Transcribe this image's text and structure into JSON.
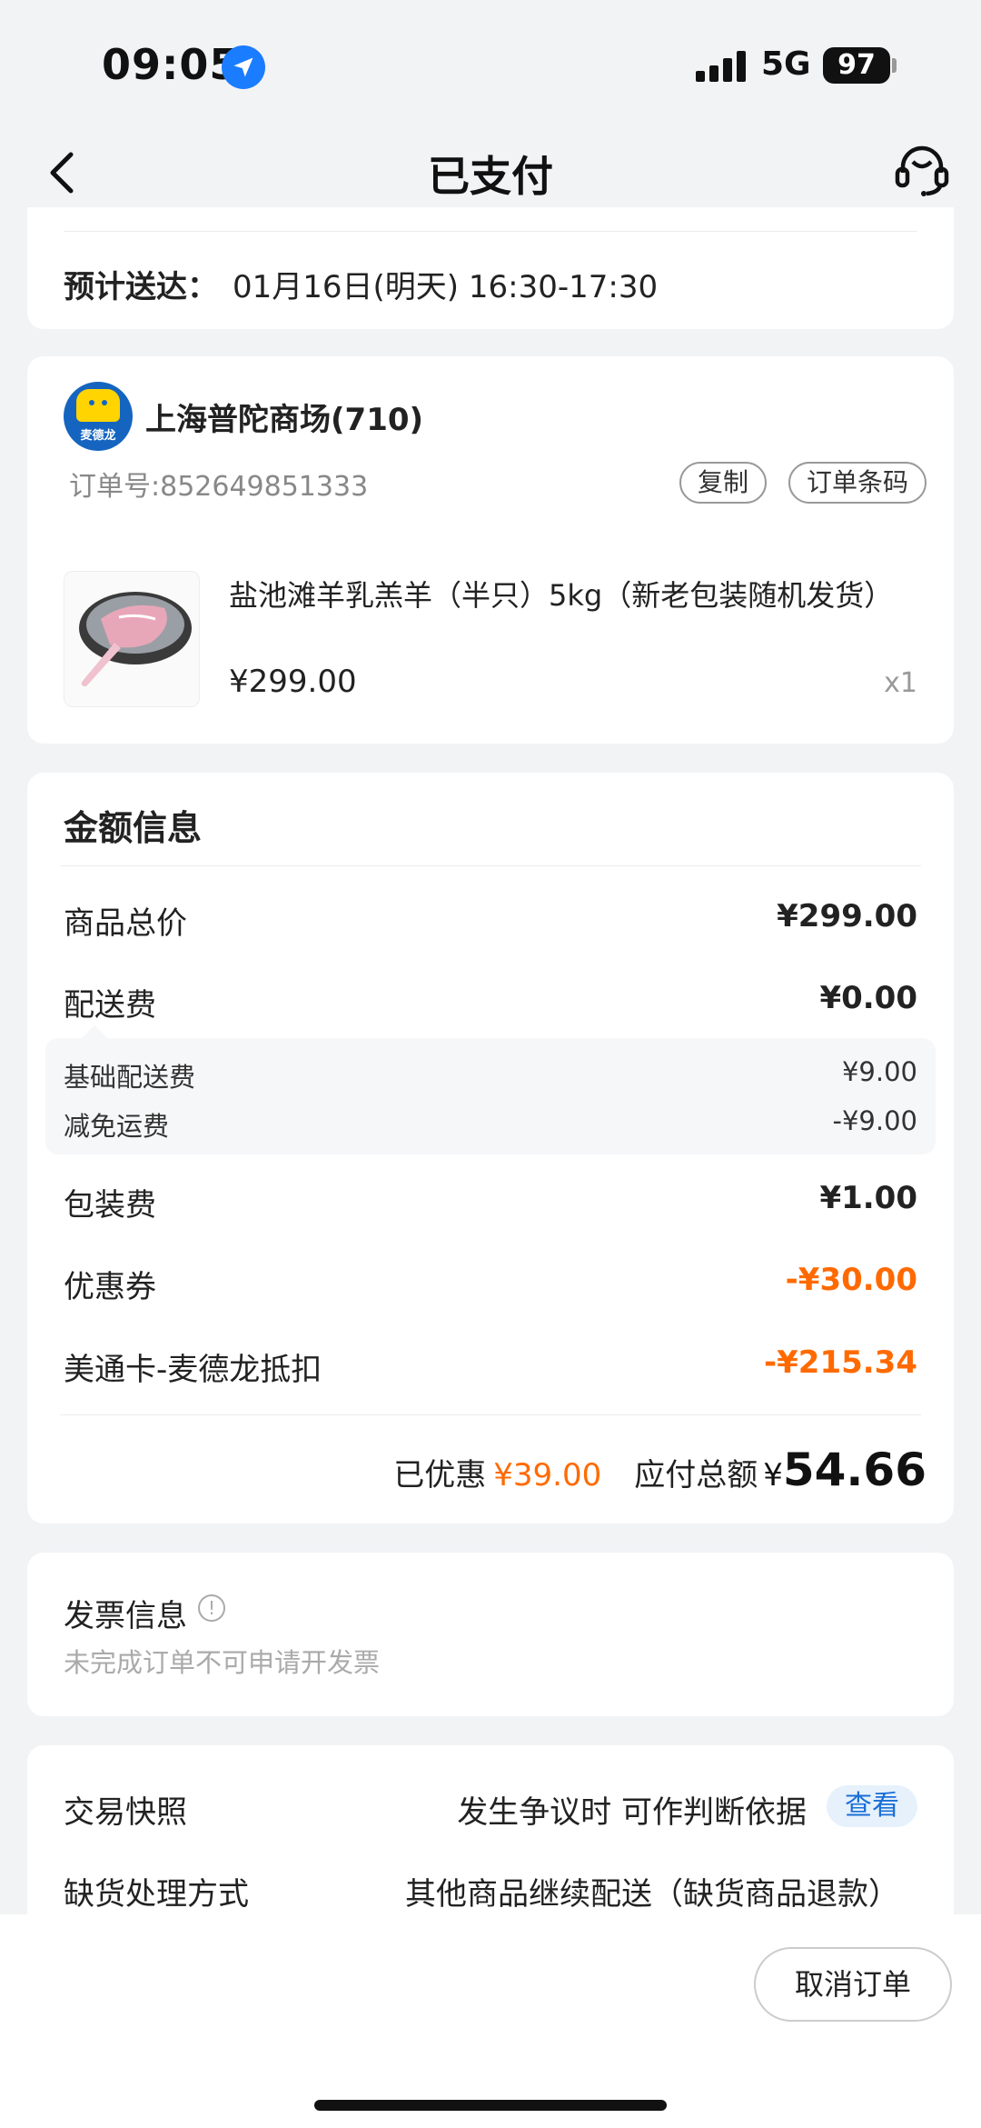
{
  "status_bar": {
    "time": "09:05",
    "network": "5G",
    "battery": "97"
  },
  "nav": {
    "title": "已支付"
  },
  "delivery": {
    "label": "预计送达：",
    "value": "01月16日(明天) 16:30-17:30"
  },
  "order": {
    "store_logo_text": "麦德龙",
    "store_name": "上海普陀商场(710)",
    "order_no": "订单号:852649851333",
    "copy_label": "复制",
    "barcode_label": "订单条码",
    "product": {
      "name": "盐池滩羊乳羔羊（半只）5kg（新老包装随机发货）",
      "price": "¥299.00",
      "qty": "x1"
    }
  },
  "amount": {
    "title": "金额信息",
    "rows": [
      {
        "label": "商品总价",
        "value": "¥299.00"
      },
      {
        "label": "配送费",
        "value": "¥0.00"
      },
      {
        "label": "包装费",
        "value": "¥1.00"
      },
      {
        "label": "优惠券",
        "value": "-¥30.00"
      },
      {
        "label": "美通卡-麦德龙抵扣",
        "value": "-¥215.34"
      }
    ],
    "delivery_detail": [
      {
        "label": "基础配送费",
        "value": "¥9.00"
      },
      {
        "label": "减免运费",
        "value": "-¥9.00"
      }
    ],
    "saved_label": "已优惠",
    "saved_value": "¥39.00",
    "due_label": "应付总额",
    "due_symbol": "¥",
    "due_value": "54.66",
    "accent_color": "#ff6a00"
  },
  "invoice": {
    "title": "发票信息",
    "note": "未完成订单不可申请开发票"
  },
  "snapshot": {
    "label": "交易快照",
    "text": "发生争议时 可作判断依据",
    "view_label": "查看",
    "oos_label": "缺货处理方式",
    "oos_value": "其他商品继续配送（缺货商品退款）"
  },
  "bottom": {
    "cancel_label": "取消订单"
  },
  "icons": {
    "back": "chevron-left-icon",
    "service": "customer-service-icon",
    "location": "location-arrow-icon",
    "info": "info-icon"
  }
}
